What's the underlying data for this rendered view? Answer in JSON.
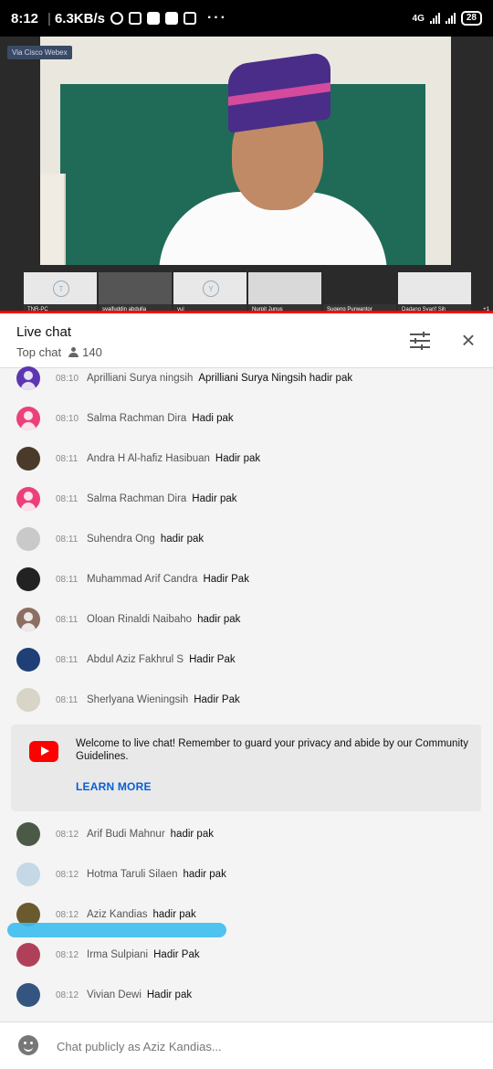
{
  "status_bar": {
    "time": "8:12",
    "speed": "6.3KB/s",
    "network": "4G",
    "battery": "28"
  },
  "video": {
    "badge": "Via Cisco Webex",
    "thumbnails": [
      {
        "label": "TNR-PC",
        "initial": "T"
      },
      {
        "label": "syaifuddin abdulla",
        "initial": ""
      },
      {
        "label": "yul",
        "initial": "Y"
      },
      {
        "label": "Nurpit Junus",
        "initial": ""
      },
      {
        "label": "Sugeng Purwantor",
        "initial": ""
      },
      {
        "label": "Dadang Syarif Sih",
        "initial": ""
      }
    ],
    "more": "+1"
  },
  "chat_header": {
    "title": "Live chat",
    "mode": "Top chat",
    "viewers": "140"
  },
  "messages": [
    {
      "time": "08:10",
      "author": "Aprilliani Surya ningsih",
      "text": "Aprilliani Surya Ningsih hadir pak",
      "avatar_color": "#5e35b1"
    },
    {
      "time": "08:10",
      "author": "Salma Rachman Dira",
      "text": "Hadi pak",
      "avatar_color": "#ec407a"
    },
    {
      "time": "08:11",
      "author": "Andra H Al-hafiz Hasibuan",
      "text": "Hadir pak",
      "avatar_color": "#4a3a2a"
    },
    {
      "time": "08:11",
      "author": "Salma Rachman Dira",
      "text": "Hadir pak",
      "avatar_color": "#ec407a"
    },
    {
      "time": "08:11",
      "author": "Suhendra Ong",
      "text": "hadir pak",
      "avatar_color": "#c9c9c9"
    },
    {
      "time": "08:11",
      "author": "Muhammad Arif Candra",
      "text": "Hadir Pak",
      "avatar_color": "#222222"
    },
    {
      "time": "08:11",
      "author": "Oloan Rinaldi Naibaho",
      "text": "hadir pak",
      "avatar_color": "#8d6e63"
    },
    {
      "time": "08:11",
      "author": "Abdul Aziz Fakhrul S",
      "text": "Hadir Pak",
      "avatar_color": "#1f3f77"
    },
    {
      "time": "08:11",
      "author": "Sherlyana Wieningsih",
      "text": "Hadir Pak",
      "avatar_color": "#d8d4c8"
    },
    {
      "time": "08:12",
      "author": "Arif Budi Mahnur",
      "text": "hadir pak",
      "avatar_color": "#4b5a46"
    },
    {
      "time": "08:12",
      "author": "Hotma Taruli Silaen",
      "text": "hadir pak",
      "avatar_color": "#c4d8e6"
    },
    {
      "time": "08:12",
      "author": "Aziz Kandias",
      "text": "hadir pak",
      "avatar_color": "#6b5a2f"
    },
    {
      "time": "08:12",
      "author": "Irma Sulpiani",
      "text": "Hadir Pak",
      "avatar_color": "#b0405a"
    },
    {
      "time": "08:12",
      "author": "Vivian Dewi",
      "text": "Hadir pak",
      "avatar_color": "#34557f"
    }
  ],
  "welcome": {
    "text": "Welcome to live chat! Remember to guard your privacy and abide by our Community Guidelines.",
    "link": "LEARN MORE"
  },
  "input": {
    "placeholder": "Chat publicly as Aziz Kandias..."
  }
}
